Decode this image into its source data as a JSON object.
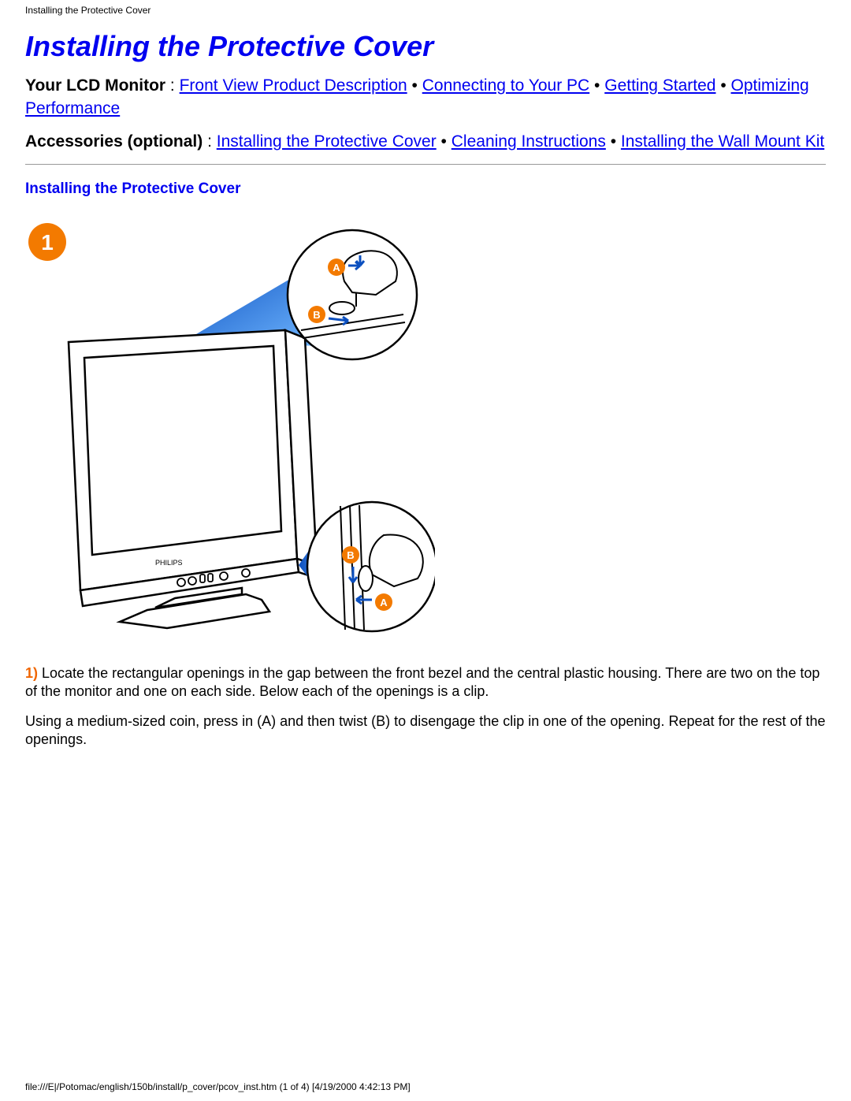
{
  "header_title": "Installing the Protective Cover",
  "page_title": "Installing the Protective Cover",
  "nav1": {
    "label": "Your LCD Monitor",
    "links": [
      "Front View Product Description",
      "Connecting to Your PC",
      "Getting Started",
      "Optimizing Performance"
    ]
  },
  "nav2": {
    "label": "Accessories (optional)",
    "links": [
      "Installing the Protective Cover",
      "Cleaning Instructions",
      "Installing the Wall Mount Kit"
    ]
  },
  "section_heading": "Installing the Protective Cover",
  "step_badge": "1",
  "step_label": "1)",
  "p1": " Locate the rectangular openings in the gap between the front bezel and the central plastic housing. There are two on the top of the monitor and one on each side. Below each of the openings is a clip.",
  "p2": "Using a medium-sized coin, press in (A) and then twist (B) to disengage the clip in one of the opening. Repeat for the rest of the openings.",
  "footer": "file:///E|/Potomac/english/150b/install/p_cover/pcov_inst.htm (1 of 4) [4/19/2000 4:42:13 PM]",
  "icon_labels": {
    "A": "A",
    "B": "B"
  },
  "monitor_brand": "PHILIPS"
}
